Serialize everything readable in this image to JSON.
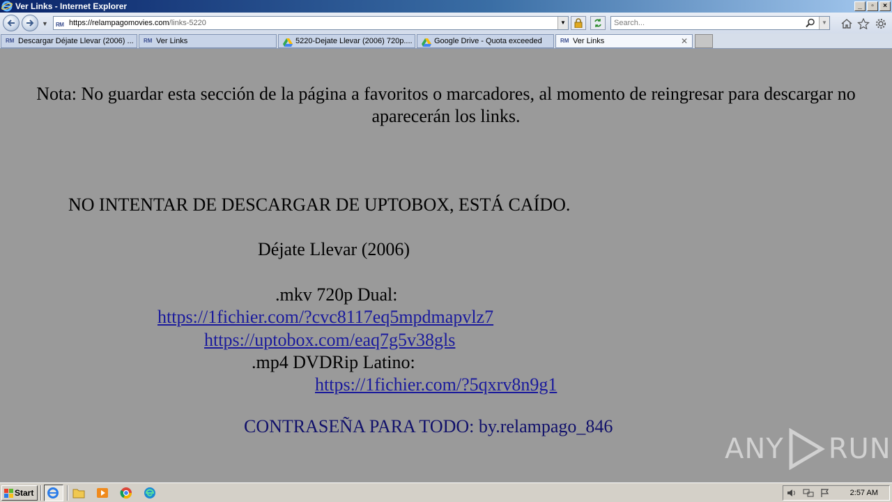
{
  "window": {
    "title": "Ver Links - Internet Explorer",
    "controls": [
      "_",
      "▫",
      "×"
    ]
  },
  "address_bar": {
    "url_host": "https://relampagomovies.com",
    "url_path": "/links-5220",
    "favicon_text": "RM"
  },
  "search": {
    "placeholder": "Search..."
  },
  "tabs": [
    {
      "label": "Descargar Déjate Llevar (2006) ...",
      "favicon": "RM",
      "active": false
    },
    {
      "label": "Ver Links",
      "favicon": "RM",
      "active": false
    },
    {
      "label": "5220-Dejate Llevar (2006) 720p....",
      "favicon": "google-drive-icon",
      "active": false
    },
    {
      "label": "Google Drive - Quota exceeded",
      "favicon": "google-drive-icon",
      "active": false
    },
    {
      "label": "Ver Links",
      "favicon": "RM",
      "active": true
    }
  ],
  "page": {
    "note": "Nota: No guardar esta sección de la página a favoritos o marcadores, al momento de reingresar para descargar no aparecerán los links.",
    "warning": "NO INTENTAR DE DESCARGAR DE UPTOBOX, ESTÁ CAÍDO.",
    "movie_title": "Déjate Llevar (2006)",
    "format_1": ".mkv 720p Dual:",
    "link_1": "https://1fichier.com/?cvc8117eq5mpdmapvlz7",
    "link_2": "https://uptobox.com/eaq7g5v38gls",
    "format_2": ".mp4 DVDRip Latino:",
    "link_3": "https://1fichier.com/?5qxrv8n9g1",
    "password": "CONTRASEÑA PARA TODO: by.relampago_846",
    "background_color": "#9a9a9a",
    "link_color": "#1a1a9c"
  },
  "watermark": {
    "left": "ANY",
    "right": "RUN"
  },
  "taskbar": {
    "start_label": "Start",
    "clock": "2:57 AM",
    "pinned": [
      "internet-explorer-icon",
      "folder-icon",
      "media-player-icon",
      "chrome-icon",
      "edge-icon"
    ]
  }
}
